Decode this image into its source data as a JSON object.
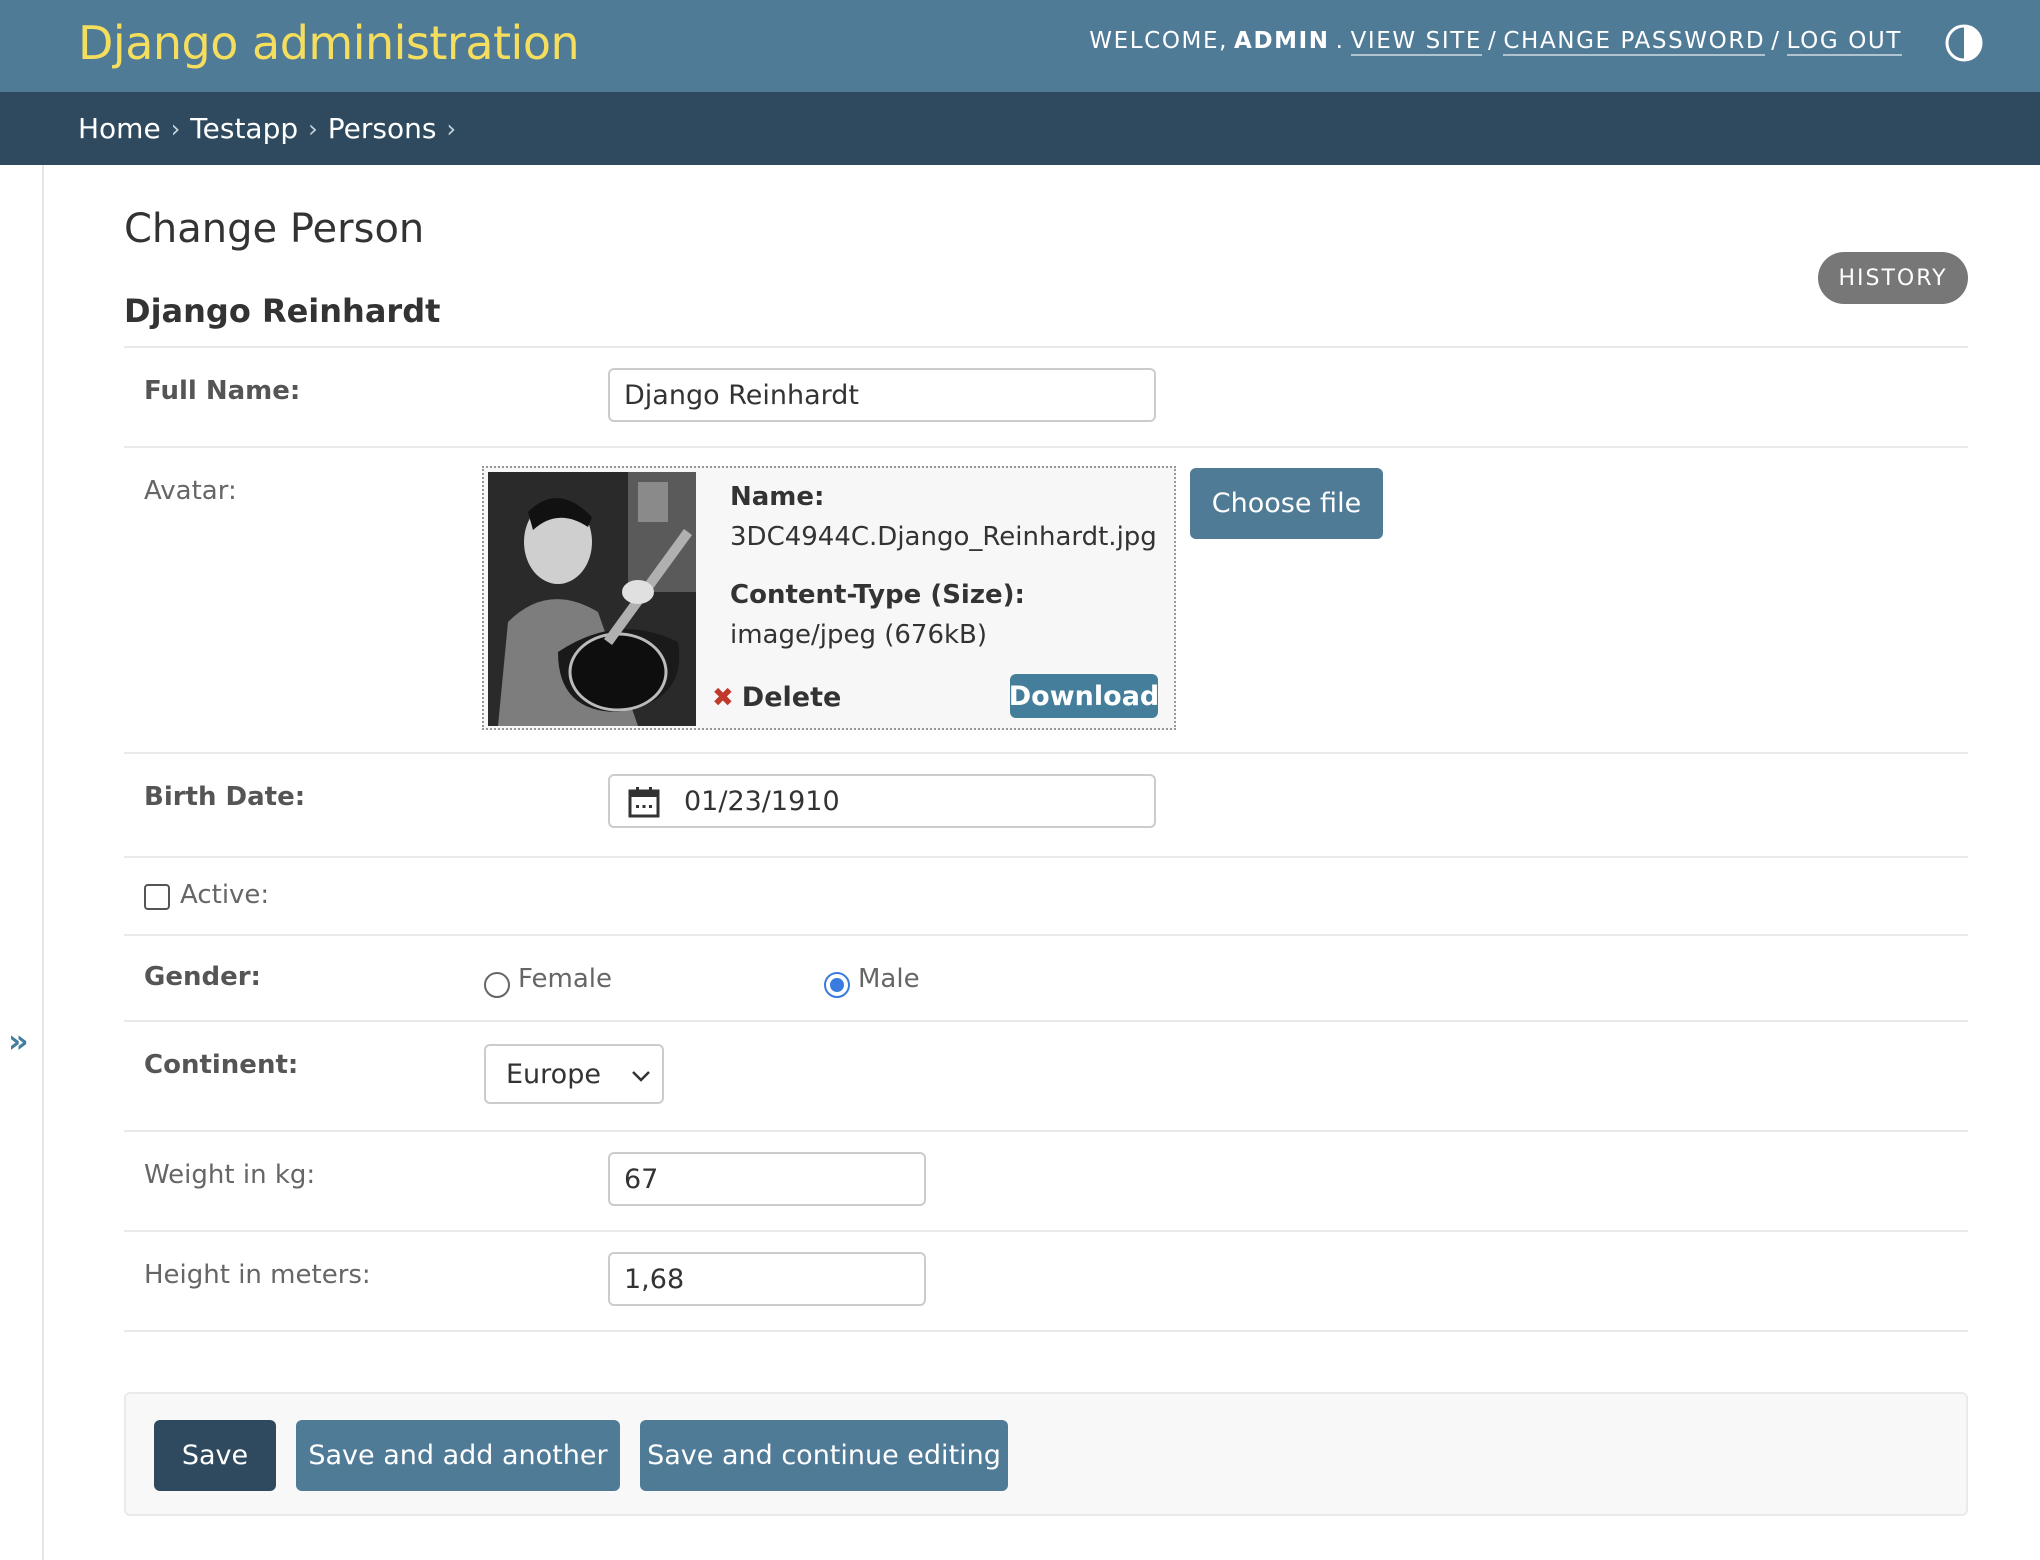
{
  "header": {
    "site_name": "Django administration",
    "welcome": "WELCOME,",
    "username": "ADMIN",
    "view_site": "VIEW SITE",
    "change_password": "CHANGE PASSWORD",
    "log_out": "LOG OUT",
    "separator": "/"
  },
  "breadcrumbs": [
    "Home",
    "Testapp",
    "Persons"
  ],
  "breadcrumb_separator": "›",
  "page": {
    "title": "Change Person",
    "object_title": "Django Reinhardt",
    "history_label": "HISTORY"
  },
  "fields": {
    "full_name": {
      "label": "Full Name:",
      "value": "Django Reinhardt"
    },
    "avatar": {
      "label": "Avatar:",
      "name_label": "Name:",
      "name_value": "3DC4944C.Django_Reinhardt.jpg",
      "type_label": "Content-Type (Size):",
      "type_value": "image/jpeg (676kB)",
      "delete_label": "Delete",
      "download_label": "Download",
      "choose_file_label": "Choose file"
    },
    "birth_date": {
      "label": "Birth Date:",
      "value": "01/23/1910"
    },
    "active": {
      "label": "Active:",
      "checked": false
    },
    "gender": {
      "label": "Gender:",
      "options": [
        "Female",
        "Male"
      ],
      "selected": "Male"
    },
    "continent": {
      "label": "Continent:",
      "value": "Europe"
    },
    "weight": {
      "label": "Weight in kg:",
      "value": "67"
    },
    "height": {
      "label": "Height in meters:",
      "value": "1,68"
    }
  },
  "submit": {
    "save": "Save",
    "save_add": "Save and add another",
    "save_continue": "Save and continue editing"
  },
  "sidebar": {
    "toggle_glyph": "»"
  },
  "colors": {
    "header_bg": "#507b97",
    "breadcrumbs_bg": "#2f4a5e",
    "brand_yellow": "#f5dd5d",
    "button_primary": "#2f4a5e",
    "button_secondary": "#507b97",
    "history_bg": "#777777",
    "radio_checked": "#3a7be0"
  }
}
